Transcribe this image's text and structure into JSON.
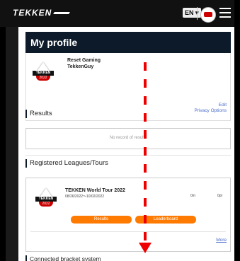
{
  "app": {
    "logo_text": "TEKKEN",
    "language": "EN ▾"
  },
  "profile": {
    "heading": "My profile",
    "line1": "Reset Gaming",
    "line2": "TekkenGuy",
    "edit_label": "Edit",
    "privacy_label": "Privacy Options",
    "badge_text": "TEKKEN",
    "badge_year": "2022"
  },
  "results": {
    "heading": "Results",
    "empty_text": "No record of results"
  },
  "leagues": {
    "heading": "Registered Leagues/Tours",
    "items": [
      {
        "title": "TEKKEN World Tour 2022",
        "dates": "08/26/2022〜10/02/2022",
        "stat1": "0m",
        "stat2": "0pt",
        "results_button": "Results",
        "leaderboard_button": "Leaderboard"
      }
    ],
    "more_label": "More"
  },
  "bracket": {
    "heading": "Connected bracket system"
  },
  "colors": {
    "header_bg": "#0d1a2a",
    "accent_orange": "#ff7a00",
    "link_blue": "#4a6cc9",
    "annotation_red": "#e00000"
  }
}
